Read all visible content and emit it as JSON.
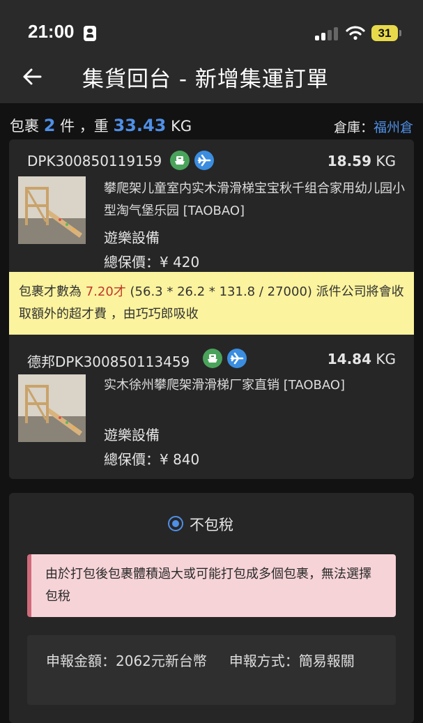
{
  "status_bar": {
    "time": "21:00",
    "battery": "31"
  },
  "header": {
    "title": "集貨回台 - 新增集運訂單"
  },
  "summary": {
    "package_prefix": "包裹",
    "package_count": "2",
    "package_unit": "件",
    "weight_prefix": "，重",
    "weight_value": "33.43",
    "weight_unit": "KG",
    "warehouse_label": "倉庫：",
    "warehouse_value": "福州倉"
  },
  "packages": [
    {
      "id": "DPK300850119159",
      "weight_value": "18.59",
      "weight_unit": "KG",
      "description": "攀爬架儿童室内实木滑滑梯宝宝秋千组合家用幼儿园小型淘气堡乐园 [TAOBAO]",
      "category": "遊樂設備",
      "insured_label": "總保價：",
      "insured_value": "¥ 420",
      "icons": [
        "ship-icon",
        "plane-icon"
      ]
    },
    {
      "id": "德邦DPK300850113459",
      "weight_value": "14.84",
      "weight_unit": "KG",
      "description": "实木徐州攀爬架滑滑梯厂家直销 [TAOBAO]",
      "category": "遊樂設備",
      "insured_label": "總保價：",
      "insured_value": "¥ 840",
      "icons": [
        "ship-icon",
        "plane-icon"
      ]
    }
  ],
  "oversize_note": {
    "prefix": "包裹才數為",
    "value": "7.20才",
    "suffix": " (56.3 * 26.2 * 131.8 / 27000) 派件公司將會收取額外的超才費 ，由巧巧郎吸收"
  },
  "tax": {
    "option_label": "不包稅",
    "warning": "由於打包後包裹體積過大或可能打包成多個包裹，無法選擇包稅"
  },
  "declaration": {
    "amount_label": "申報金額：",
    "amount_value": "2062元新台幣",
    "method_label": "申報方式：",
    "method_value": "簡易報關"
  },
  "colors": {
    "accent": "#4f8fe6",
    "ship_badge": "#4aa35a",
    "plane_badge": "#3b8de0",
    "note_yellow": "#fbf39d",
    "note_red": "#c0392b",
    "warning_pink": "#f6d3d7"
  }
}
